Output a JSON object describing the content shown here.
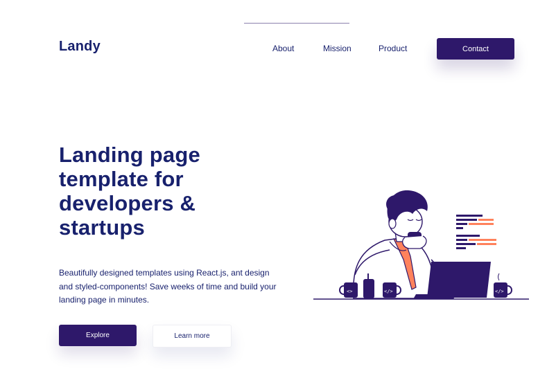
{
  "header": {
    "logo": "Landy",
    "nav": [
      {
        "label": "About"
      },
      {
        "label": "Mission"
      },
      {
        "label": "Product"
      }
    ],
    "contact_label": "Contact"
  },
  "hero": {
    "title_lines": [
      "Landing page",
      "template for",
      "developers &",
      "startups"
    ],
    "description": "Beautifully designed templates using React.js, ant design and styled-components! Save weeks of time and build your landing page in minutes.",
    "explore_label": "Explore",
    "learn_more_label": "Learn more"
  },
  "colors": {
    "brand": "#2e186a",
    "text": "#18216d",
    "accent": "#ff825c"
  },
  "icons": [
    "developer-illustration",
    "coffee-mug-icon",
    "laptop-icon",
    "code-lines-icon"
  ]
}
